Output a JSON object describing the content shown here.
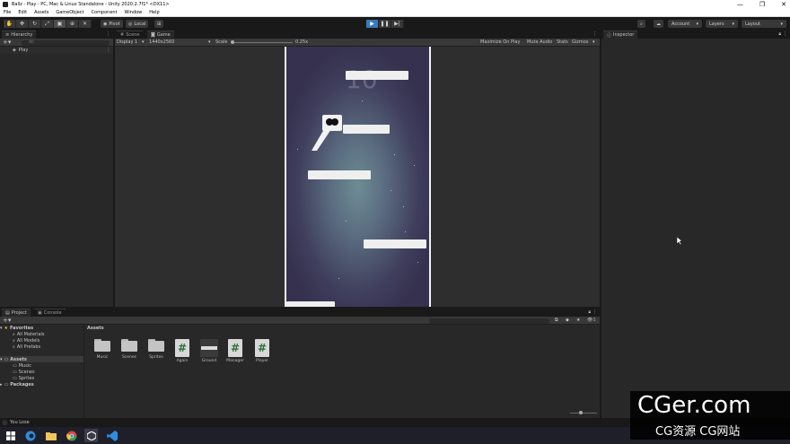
{
  "window": {
    "title": "Ballz - Play - PC, Mac & Linux Standalone - Unity 2020.2.7f1* <DX11>",
    "controls": [
      "—",
      "❐",
      "✕"
    ]
  },
  "menu": [
    "File",
    "Edit",
    "Assets",
    "GameObject",
    "Component",
    "Window",
    "Help"
  ],
  "toolbar": {
    "pivot_label": "Pivot",
    "local_label": "Local",
    "account_label": "Account",
    "layers_label": "Layers",
    "layout_label": "Layout"
  },
  "hierarchy": {
    "tab_label": "Hierarchy",
    "search_placeholder": "All",
    "scene_name": "Play"
  },
  "game_panel": {
    "tabs": [
      "Scene",
      "Game"
    ],
    "display": "Display 1",
    "resolution": "1440x2560",
    "scale_label": "Scale",
    "scale_value": "0.25x",
    "options": [
      "Maximize On Play",
      "Mute Audio",
      "Stats",
      "Gizmos"
    ],
    "score_ghost": "10"
  },
  "inspector": {
    "tab_label": "Inspector"
  },
  "project": {
    "tabs": [
      "Project",
      "Console"
    ],
    "breadcrumb": "Assets",
    "tree": {
      "favorites_label": "Favorites",
      "favorites": [
        "All Materials",
        "All Models",
        "All Prefabs"
      ],
      "assets_label": "Assets",
      "asset_folders": [
        "Music",
        "Scenes",
        "Sprites"
      ],
      "packages_label": "Packages"
    },
    "assets": [
      {
        "name": "Music",
        "kind": "folder"
      },
      {
        "name": "Scenes",
        "kind": "folder"
      },
      {
        "name": "Sprites",
        "kind": "folder"
      },
      {
        "name": "Again",
        "kind": "script"
      },
      {
        "name": "Ground",
        "kind": "prefab"
      },
      {
        "name": "Manager",
        "kind": "script"
      },
      {
        "name": "Player",
        "kind": "script"
      }
    ],
    "badge_count": "5"
  },
  "status": {
    "message": "You Lose"
  },
  "watermark": {
    "line1": "CGer.com",
    "line2": "CG资源 CG网站"
  },
  "colors": {
    "play_accent": "#3a79bb",
    "editor_bg": "#282828",
    "platform": "#efefef"
  }
}
